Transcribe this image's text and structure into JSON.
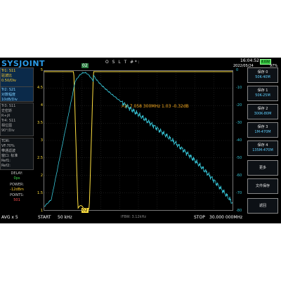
{
  "header": {
    "logo": "SYSJOINT",
    "mode": "O S L T #*:",
    "time": "16:04:52",
    "date": "2022/05/24",
    "battery_label": "4.03V",
    "battery_pct": "97%"
  },
  "traces": {
    "tr1": [
      "Tr1:  S11",
      "驻波比",
      "0.50/Div"
    ],
    "tr2": [
      "Tr2:  S21",
      "对数幅度",
      "10dB/Div"
    ],
    "tr3": [
      "Tr3:  S11",
      "史密斯",
      "R+jX",
      "Tr4:  S11",
      "相位图",
      "90°/Div"
    ],
    "info": [
      "TDR:",
      "VF:70%",
      "带通滤波",
      "窗口: 标准",
      "Ref1:",
      "Ref2:"
    ]
  },
  "status": {
    "delay_label": "DELAY:",
    "delay_value": "0ps",
    "power_label": "POWER:",
    "power_value": "-12dBm",
    "points_label": "POINTS:",
    "points_value": "501",
    "avg": "AVG x 5"
  },
  "axis_left": [
    "5",
    "4.5",
    "4",
    "3.5",
    "3",
    "2.5",
    "2",
    "1.5",
    "1"
  ],
  "axis_right": [
    "0",
    "-10",
    "-20",
    "-30",
    "-40",
    "-50",
    "-60",
    "-70",
    "-80"
  ],
  "marker": {
    "text": ">2:      7.058 300MHz    1.03     -0.32dB",
    "label_top": "02",
    "label_bottom": "02"
  },
  "footer": {
    "start_label": "START",
    "start_value": "50 kHz",
    "ifbw": "IFBW: 3.12kHz",
    "stop_label": "STOP",
    "stop_value": "30.000 000MHz"
  },
  "buttons": [
    {
      "label": "保存 0",
      "sub": "50K-40M"
    },
    {
      "label": "保存 1",
      "sub": "50K-25M"
    },
    {
      "label": "保存 2",
      "sub": "300K-80M"
    },
    {
      "label": "保存 3",
      "sub": "1M-470M"
    },
    {
      "label": "保存 4",
      "sub": "135M-470M"
    },
    {
      "label": "更多",
      "sub": ""
    },
    {
      "label": "文件保存",
      "sub": ""
    },
    {
      "label": "返回",
      "sub": ""
    }
  ],
  "colors": {
    "s21": "#36c6d8",
    "swr": "#ffe040",
    "marker": "#ffb020"
  }
}
